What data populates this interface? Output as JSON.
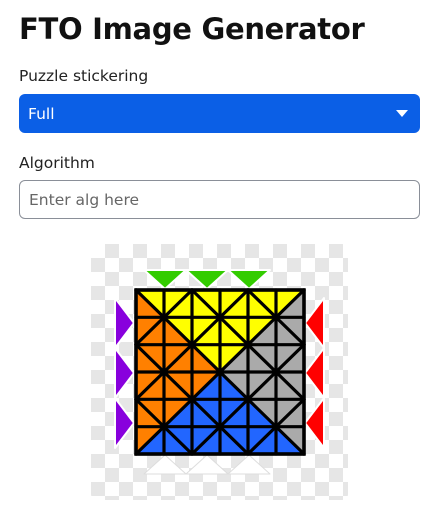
{
  "page": {
    "title": "FTO Image Generator"
  },
  "stickering": {
    "label": "Puzzle stickering",
    "selected": "Full"
  },
  "algorithm": {
    "label": "Algorithm",
    "value": "",
    "placeholder": "Enter alg here"
  },
  "puzzle": {
    "face_colors": {
      "top": "#ffff00",
      "left": "#ff8000",
      "right": "#aaaaaa",
      "bottom": "#2266ff",
      "top_hint": "#33cc00",
      "left_hint": "#8800dd",
      "right_hint": "#ff0000",
      "bottom_hint": "#ffffff"
    }
  }
}
